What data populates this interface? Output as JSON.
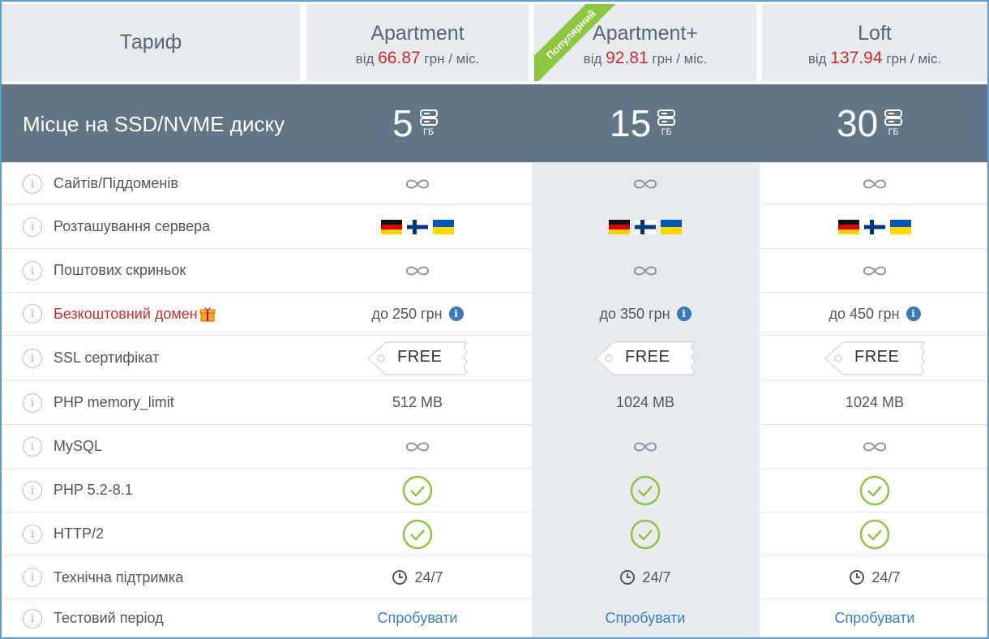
{
  "header": {
    "tarif_label": "Тариф",
    "popular_badge": "Популярний",
    "plans": [
      {
        "name": "Apartment",
        "price_prefix": "від",
        "price": "66.87",
        "price_suffix": "грн / міс."
      },
      {
        "name": "Apartment+",
        "price_prefix": "від",
        "price": "92.81",
        "price_suffix": "грн / міс."
      },
      {
        "name": "Loft",
        "price_prefix": "від",
        "price": "137.94",
        "price_suffix": "грн / міс."
      }
    ]
  },
  "disk": {
    "title": "Місце на SSD/NVME диску",
    "unit": "ГБ",
    "values": [
      "5",
      "15",
      "30"
    ]
  },
  "features": {
    "sites": "Сайтів/Піддоменів",
    "location": "Розташування сервера",
    "mailboxes": "Поштових скриньок",
    "free_domain": "Безкоштовний домен",
    "ssl": "SSL сертифікат",
    "php_memory": "PHP memory_limit",
    "mysql": "MySQL",
    "php": "PHP 5.2-8.1",
    "http2": "HTTP/2",
    "support": "Технічна підтримка",
    "trial": "Тестовий період"
  },
  "values": {
    "domain": [
      "до 250 грн",
      "до 350 грн",
      "до 450 грн"
    ],
    "ssl_label": "FREE",
    "php_memory": [
      "512 MB",
      "1024 MB",
      "1024 MB"
    ],
    "support": "24/7",
    "trial_link": "Спробувати"
  },
  "icons": {
    "info": "info-circle-icon",
    "unlimited": "infinity-icon",
    "check": "check-circle-icon",
    "clock": "clock-icon",
    "disk": "server-disk-icon",
    "gift": "gift-icon",
    "flags": [
      "flag-de-icon",
      "flag-fi-icon",
      "flag-ua-icon"
    ]
  },
  "colors": {
    "accent_blue": "#3a7fc0",
    "price_red": "#d42b2b",
    "band_gray": "#627586",
    "header_bg": "#e7ebef",
    "check_green": "#8cc63f"
  }
}
